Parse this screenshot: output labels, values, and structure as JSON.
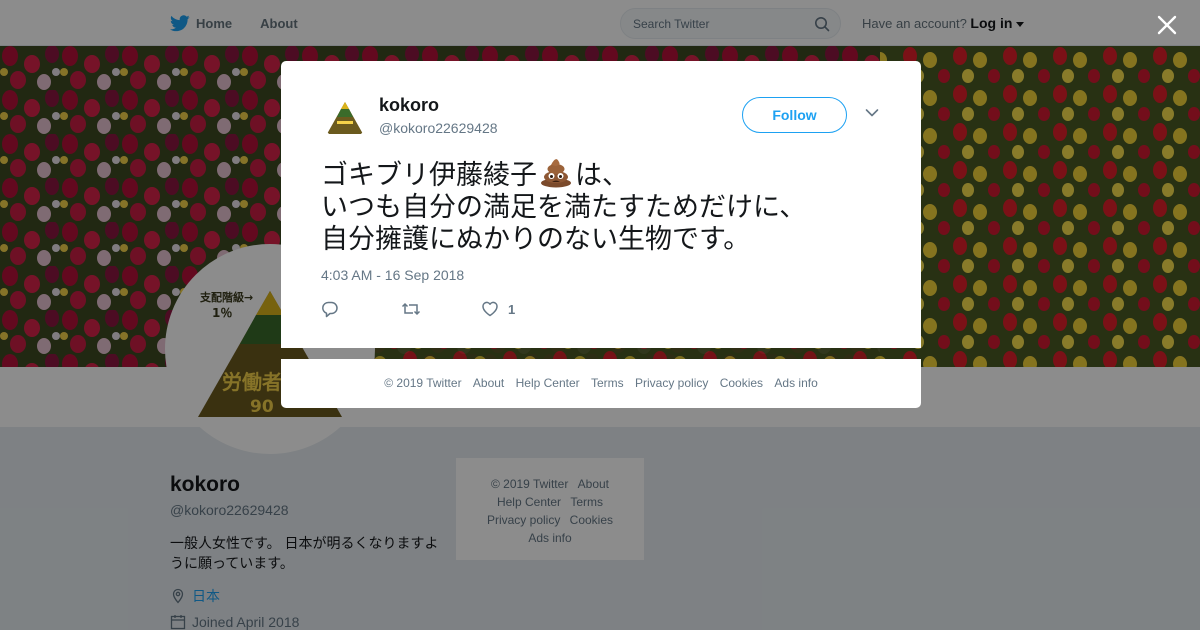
{
  "topnav": {
    "home_label": "Home",
    "about_label": "About",
    "search_placeholder": "Search Twitter",
    "account_prompt": "Have an account?",
    "login_label": "Log in"
  },
  "profile": {
    "name": "kokoro",
    "handle": "@kokoro22629428",
    "bio": "一般人女性です。 日本が明るくなりますように願っています。",
    "location": "日本",
    "joined": "Joined April 2018",
    "avatar_text": {
      "top_label": "支配階級→",
      "top_pct": "1％",
      "bottom_label": "労働者",
      "bottom_pct": "90"
    }
  },
  "side_footer": {
    "links": [
      "© 2019 Twitter",
      "About",
      "Help Center",
      "Terms",
      "Privacy policy",
      "Cookies",
      "Ads info"
    ]
  },
  "tweet": {
    "author_name": "kokoro",
    "author_handle": "@kokoro22629428",
    "follow_label": "Follow",
    "text_line1_a": "ゴキブリ伊藤綾子",
    "text_line1_b": "は、",
    "text_line2": "いつも自分の満足を満たすためだけに、",
    "text_line3": "自分擁護にぬかりのない生物です。",
    "emoji_icon": "pile-of-poo-icon",
    "timestamp": "4:03 AM - 16 Sep 2018",
    "like_count": "1"
  },
  "modal_footer": {
    "links": [
      "© 2019 Twitter",
      "About",
      "Help Center",
      "Terms",
      "Privacy policy",
      "Cookies",
      "Ads info"
    ]
  },
  "colors": {
    "brand": "#1da1f2",
    "muted": "#657786",
    "text": "#14171a",
    "overlay": "rgba(0,0,0,0.45)"
  }
}
